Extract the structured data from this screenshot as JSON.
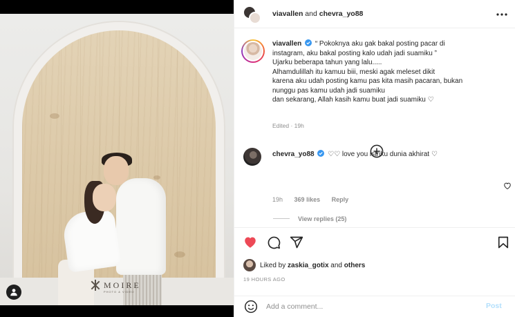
{
  "header": {
    "user1": "viavallen",
    "joiner": "and",
    "user2": "chevra_yo88"
  },
  "media": {
    "brand_name": "MOIRE",
    "brand_sub": "PHOTO & VIDEO"
  },
  "caption": {
    "username": "viavallen",
    "lines": [
      "“ Pokoknya aku gak bakal posting pacar di",
      "instagram, aku bakal posting kalo udah jadi suamiku ”",
      "Ujarku beberapa tahun yang lalu.....",
      "Alhamdulillah itu kamuu biii, meski agak meleset dikit",
      "karena aku udah posting kamu pas kita masih pacaran, bukan",
      "nunggu pas kamu udah jadi suamiku",
      "dan sekarang, Allah kasih kamu buat jadi suamiku ♡"
    ],
    "edited": "Edited · 19h"
  },
  "comment": {
    "username": "chevra_yo88",
    "text": "♡♡ love you istriku dunia akhirat ♡",
    "time": "19h",
    "likes": "369 likes",
    "reply": "Reply",
    "view_replies": "View replies (25)"
  },
  "likes": {
    "prefix": "Liked by",
    "user": "zaskia_gotix",
    "suffix": "and others"
  },
  "timeago": "19 HOURS AGO",
  "composer": {
    "placeholder": "Add a comment...",
    "post_label": "Post"
  },
  "colors": {
    "like_red": "#ed4956",
    "verified_blue": "#3897f0",
    "post_disabled": "#b2dffc",
    "muted": "#8e8e8e"
  }
}
